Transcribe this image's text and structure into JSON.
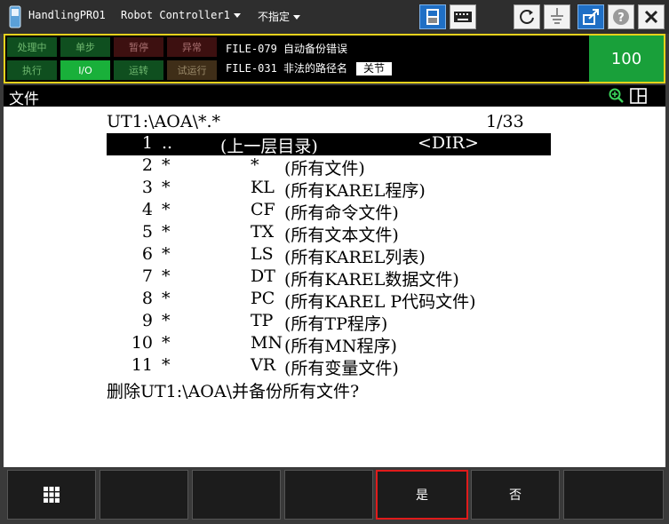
{
  "window": {
    "app_name": "HandlingPRO1",
    "controller": "Robot Controller1",
    "group": "不指定"
  },
  "status": {
    "leds": [
      {
        "label": "处理中",
        "style": "green"
      },
      {
        "label": "单步",
        "style": "green"
      },
      {
        "label": "暂停",
        "style": "red"
      },
      {
        "label": "异常",
        "style": "red"
      },
      {
        "label": "执行",
        "style": "green"
      },
      {
        "label": "I/O",
        "style": "on"
      },
      {
        "label": "运转",
        "style": "green"
      },
      {
        "label": "试运行",
        "style": "brown"
      }
    ],
    "alarm_line1": "FILE-079 自动备份错误",
    "alarm_line2": "FILE-031 非法的路径名",
    "close_label": "关节",
    "override": "100"
  },
  "screen": {
    "title": "文件",
    "path": "UT1:\\AOA\\*.*",
    "page_indicator": "1/33",
    "rows": [
      {
        "num": "1",
        "name": "..",
        "type": "",
        "desc": "(上一层目录)",
        "tag": "<DIR>"
      },
      {
        "num": "2",
        "name": "*",
        "type": "*",
        "desc": "(所有文件)",
        "tag": ""
      },
      {
        "num": "3",
        "name": "*",
        "type": "KL",
        "desc": "(所有KAREL程序)",
        "tag": ""
      },
      {
        "num": "4",
        "name": "*",
        "type": "CF",
        "desc": "(所有命令文件)",
        "tag": ""
      },
      {
        "num": "5",
        "name": "*",
        "type": "TX",
        "desc": "(所有文本文件)",
        "tag": ""
      },
      {
        "num": "6",
        "name": "*",
        "type": "LS",
        "desc": "(所有KAREL列表)",
        "tag": ""
      },
      {
        "num": "7",
        "name": "*",
        "type": "DT",
        "desc": "(所有KAREL数据文件)",
        "tag": ""
      },
      {
        "num": "8",
        "name": "*",
        "type": "PC",
        "desc": "(所有KAREL P代码文件)",
        "tag": ""
      },
      {
        "num": "9",
        "name": "*",
        "type": "TP",
        "desc": "(所有TP程序)",
        "tag": ""
      },
      {
        "num": "10",
        "name": "*",
        "type": "MN",
        "desc": "(所有MN程序)",
        "tag": ""
      },
      {
        "num": "11",
        "name": "*",
        "type": "VR",
        "desc": "(所有变量文件)",
        "tag": ""
      }
    ],
    "prompt": "删除UT1:\\AOA\\并备份所有文件?"
  },
  "fkeys": {
    "yes": "是",
    "no": "否"
  }
}
